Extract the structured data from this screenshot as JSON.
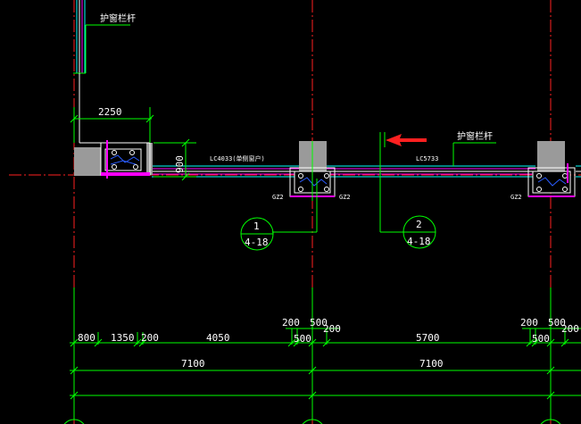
{
  "colors": {
    "background": "#000000",
    "axis": "#ff0000",
    "dimension": "#00ff00",
    "wall_cyan": "#00ffff",
    "wall_magenta": "#ff00ff",
    "column_fill": "#9a9a9a",
    "window_blue": "#0000ff",
    "arrow": "#ff0000",
    "text": "#ffffff"
  },
  "labels": {
    "railing_top": "护窗栏杆",
    "railing_right": "护窗栏杆",
    "window_left": "LC4033(单侧窗户)",
    "window_mid": "LC5733",
    "gz_mid_left": "GZ2",
    "gz_mid_right": "GZ2",
    "gz_right": "GZ2"
  },
  "callouts": [
    {
      "number": "1",
      "sheet": "4-18"
    },
    {
      "number": "2",
      "sheet": "4-18"
    }
  ],
  "dimensions": {
    "top_width": "2250",
    "vertical": "900",
    "row_upper": {
      "d200a": "200",
      "d500a": "500",
      "d200b": "200",
      "d500b": "500"
    },
    "row_main": [
      "800",
      "1350",
      "200",
      "4050",
      "500",
      "200",
      "5700",
      "500",
      "200"
    ],
    "bay_totals": [
      "7100",
      "7100"
    ]
  }
}
